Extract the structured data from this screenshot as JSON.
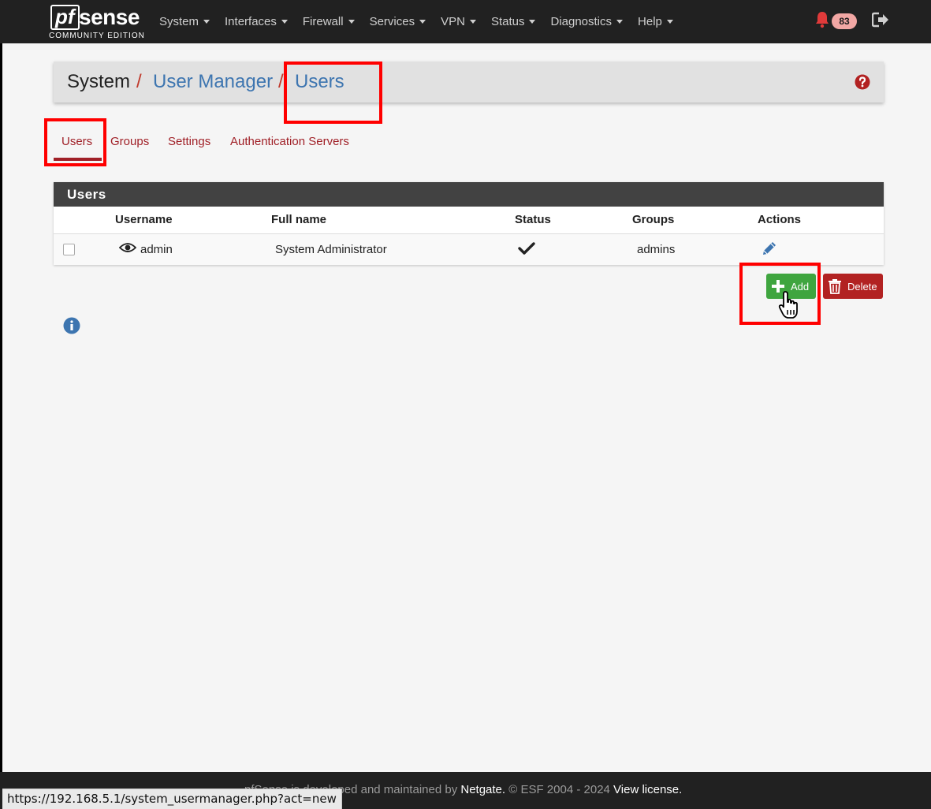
{
  "brand": {
    "logo_mark": "pf",
    "logo_word": "sense",
    "edition": "COMMUNITY EDITION"
  },
  "nav": {
    "items": [
      {
        "label": "System"
      },
      {
        "label": "Interfaces"
      },
      {
        "label": "Firewall"
      },
      {
        "label": "Services"
      },
      {
        "label": "VPN"
      },
      {
        "label": "Status"
      },
      {
        "label": "Diagnostics"
      },
      {
        "label": "Help"
      }
    ],
    "notification_count": "83"
  },
  "breadcrumb": {
    "system": "System",
    "sep": "/",
    "user_manager": "User Manager",
    "users": "Users"
  },
  "tabs": [
    {
      "label": "Users",
      "active": true
    },
    {
      "label": "Groups"
    },
    {
      "label": "Settings"
    },
    {
      "label": "Authentication Servers"
    }
  ],
  "users_panel": {
    "title": "Users",
    "columns": {
      "username": "Username",
      "full_name": "Full name",
      "status": "Status",
      "groups": "Groups",
      "actions": "Actions"
    },
    "rows": [
      {
        "username": "admin",
        "full_name": "System Administrator",
        "groups": "admins",
        "status": "enabled"
      }
    ]
  },
  "buttons": {
    "add": "Add",
    "delete": "Delete"
  },
  "footer": {
    "part1": "pfSense is developed and maintained by ",
    "netgate": "Netgate.",
    "part2": " © ESF 2004 - 2024 ",
    "license": "View license."
  },
  "statusbar_url": "https://192.168.5.1/system_usermanager.php?act=new",
  "colors": {
    "navbar": "#212121",
    "link_red": "#a02027",
    "link_blue": "#3d75b0",
    "add_green": "#3fa53f",
    "delete_red": "#b22222",
    "annotation": "#ff0000"
  },
  "icons": [
    "bell-icon",
    "logout-icon",
    "help-icon",
    "eye-icon",
    "check-icon",
    "pencil-icon",
    "plus-icon",
    "trash-icon",
    "info-icon",
    "hand-cursor-icon"
  ]
}
